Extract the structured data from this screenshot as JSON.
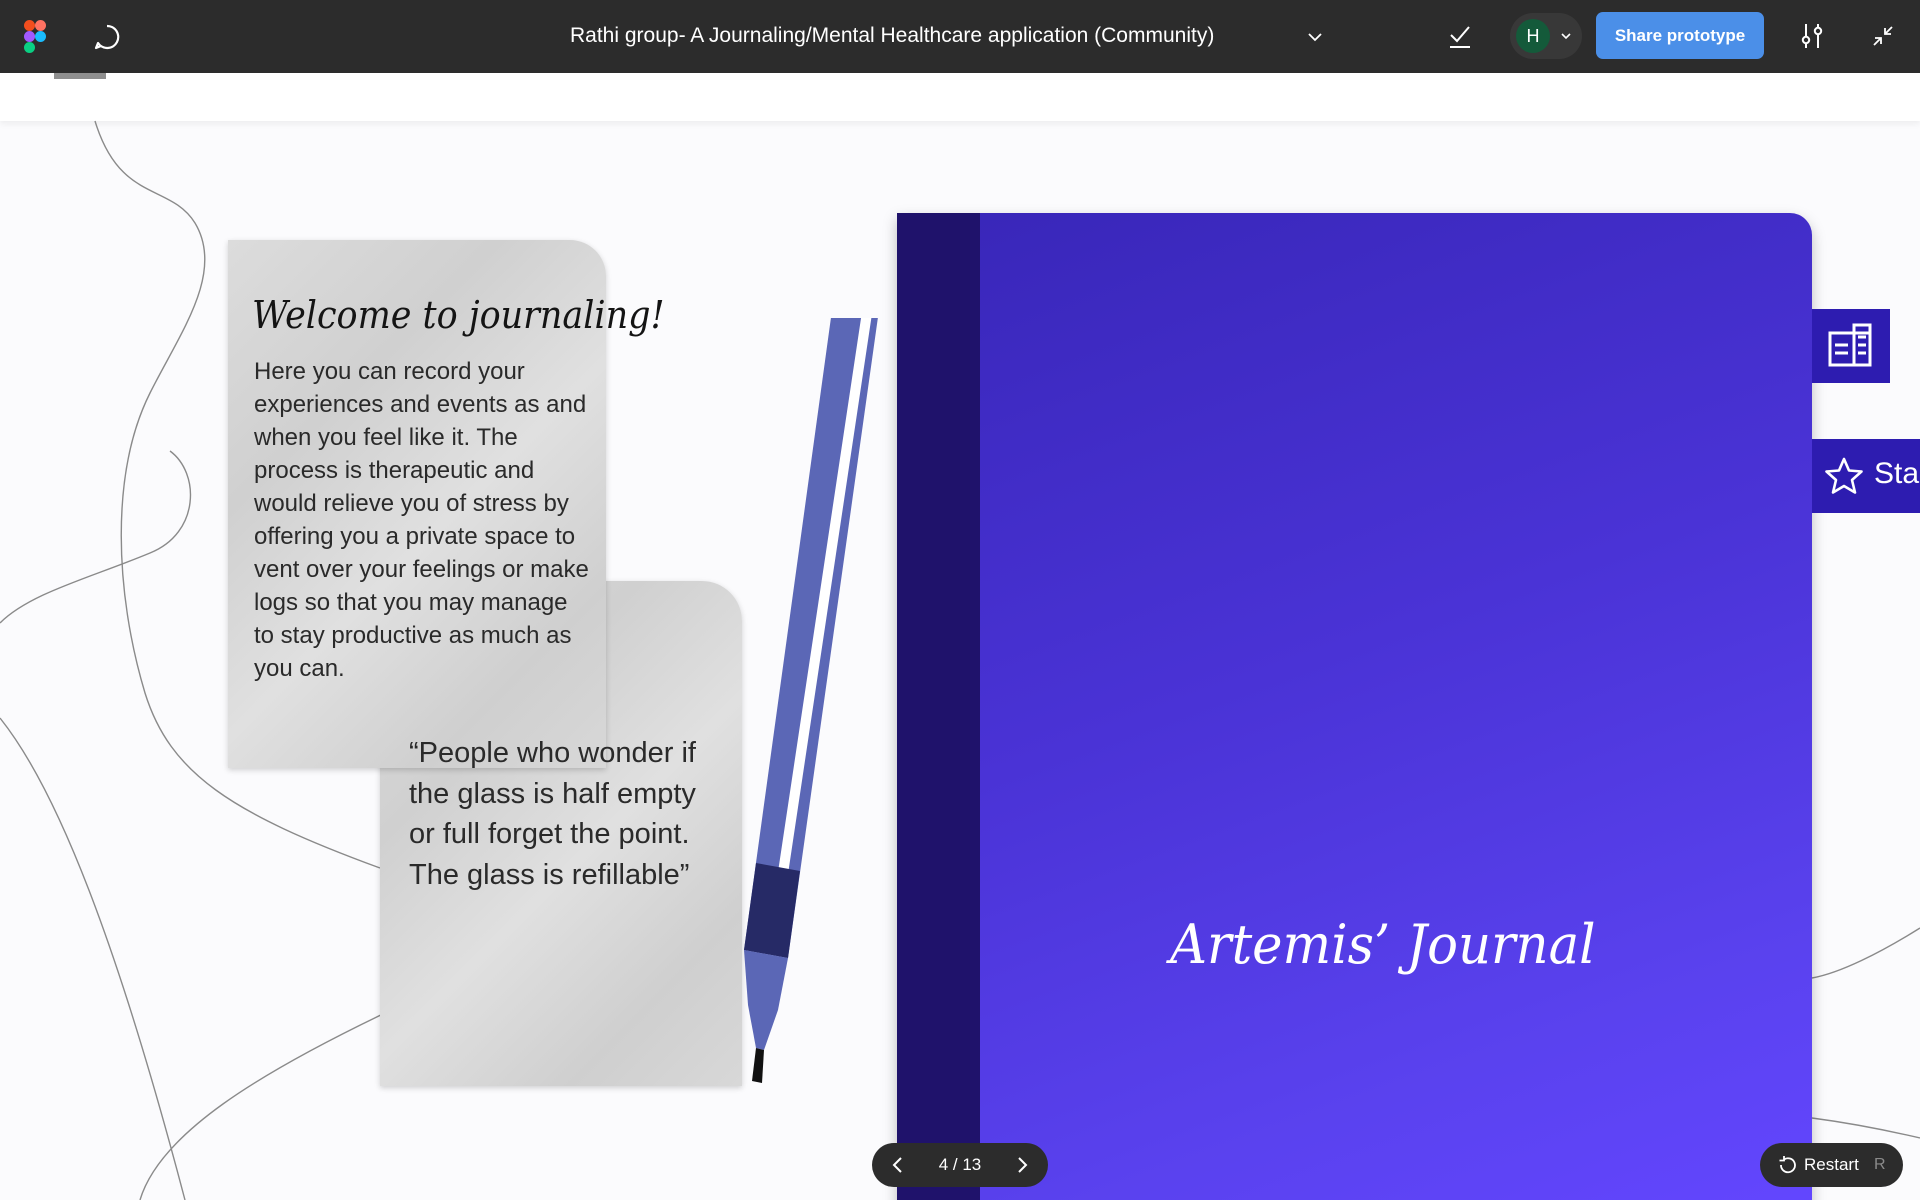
{
  "toolbar": {
    "file_title": "Rathi group- A Journaling/Mental Healthcare application (Community)",
    "user_initial": "H",
    "share_label": "Share prototype",
    "colors": {
      "background": "#2c2c2c",
      "share_button": "#4b8fe8",
      "avatar": "#145a3a"
    },
    "icons": [
      "figma-logo-icon",
      "comment-icon",
      "chevron-down-icon",
      "checkmark-icon",
      "settings-sliders-icon",
      "collapse-icon"
    ]
  },
  "welcome_note": {
    "title": "Welcome to journaling!",
    "body": "Here you can record your experiences and events as and when you feel like it. The process is therapeutic and  would relieve you of stress by offering you a private space to vent over your feelings or make logs so that you may manage to stay productive as much as you can."
  },
  "quote_note": {
    "text": "“People who wonder if the glass is half empty or full forget the point. The glass is refillable”"
  },
  "journal": {
    "title": "Artemis’ Journal",
    "colors": {
      "cover_top": "#3826b8",
      "cover_bottom": "#6346ff",
      "spine": "#1f126b",
      "tab": "#2d1cb0"
    }
  },
  "side_tabs": [
    {
      "icon": "dashboard-icon",
      "label": ""
    },
    {
      "icon": "star-icon",
      "label": "Star"
    }
  ],
  "pager": {
    "current": 4,
    "total": 13,
    "display": "4 / 13"
  },
  "restart": {
    "label": "Restart",
    "shortcut": "R"
  }
}
